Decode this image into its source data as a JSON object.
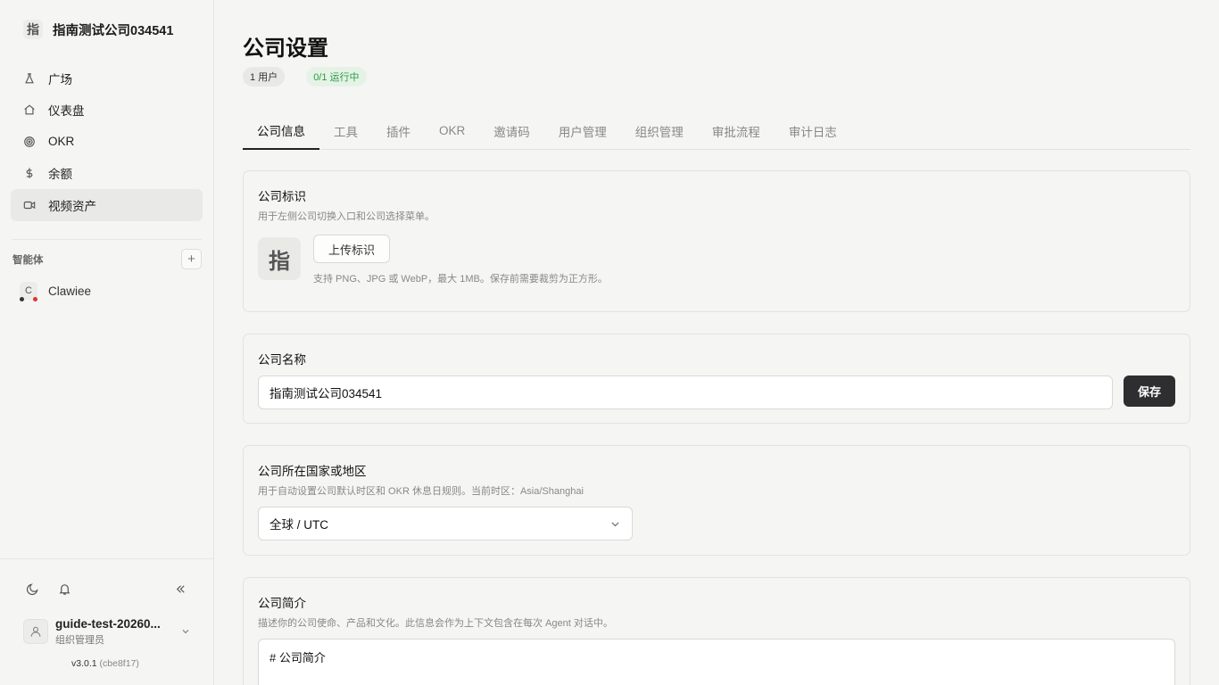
{
  "sidebar": {
    "company": {
      "logo_char": "指",
      "name": "指南测试公司034541"
    },
    "nav": [
      {
        "label": "广场",
        "icon": "flask-icon"
      },
      {
        "label": "仪表盘",
        "icon": "home-icon"
      },
      {
        "label": "OKR",
        "icon": "target-icon"
      },
      {
        "label": "余额",
        "icon": "dollar-icon"
      },
      {
        "label": "视频资产",
        "icon": "video-icon"
      }
    ],
    "agents_title": "智能体",
    "add_agent_symbol": "+",
    "agents": [
      {
        "avatar_char": "C",
        "name": "Clawiee"
      }
    ],
    "user": {
      "name": "guide-test-20260...",
      "role": "组织管理员"
    },
    "version": {
      "number": "v3.0.1",
      "hash": "(cbe8f17)"
    }
  },
  "main": {
    "title": "公司设置",
    "badges": {
      "users": "1 用户",
      "running": "0/1 运行中"
    },
    "tabs": [
      "公司信息",
      "工具",
      "插件",
      "OKR",
      "邀请码",
      "用户管理",
      "组织管理",
      "审批流程",
      "审计日志"
    ],
    "logo_section": {
      "title": "公司标识",
      "desc": "用于左侧公司切换入口和公司选择菜单。",
      "preview_char": "指",
      "upload_label": "上传标识",
      "hint": "支持 PNG、JPG 或 WebP，最大 1MB。保存前需要裁剪为正方形。"
    },
    "name_section": {
      "title": "公司名称",
      "value": "指南测试公司034541",
      "save_label": "保存"
    },
    "region_section": {
      "title": "公司所在国家或地区",
      "desc": "用于自动设置公司默认时区和 OKR 休息日规则。当前时区：Asia/Shanghai",
      "selected": "全球 / UTC"
    },
    "intro_section": {
      "title": "公司简介",
      "desc": "描述你的公司使命、产品和文化。此信息会作为上下文包含在每次 Agent 对话中。",
      "value": "# 公司简介"
    }
  },
  "colors": {
    "background": "#f5f5f4",
    "primary_button": "#2e2e30",
    "running_badge_text": "#2a9a3e",
    "running_badge_bg": "#e5f3e7"
  }
}
